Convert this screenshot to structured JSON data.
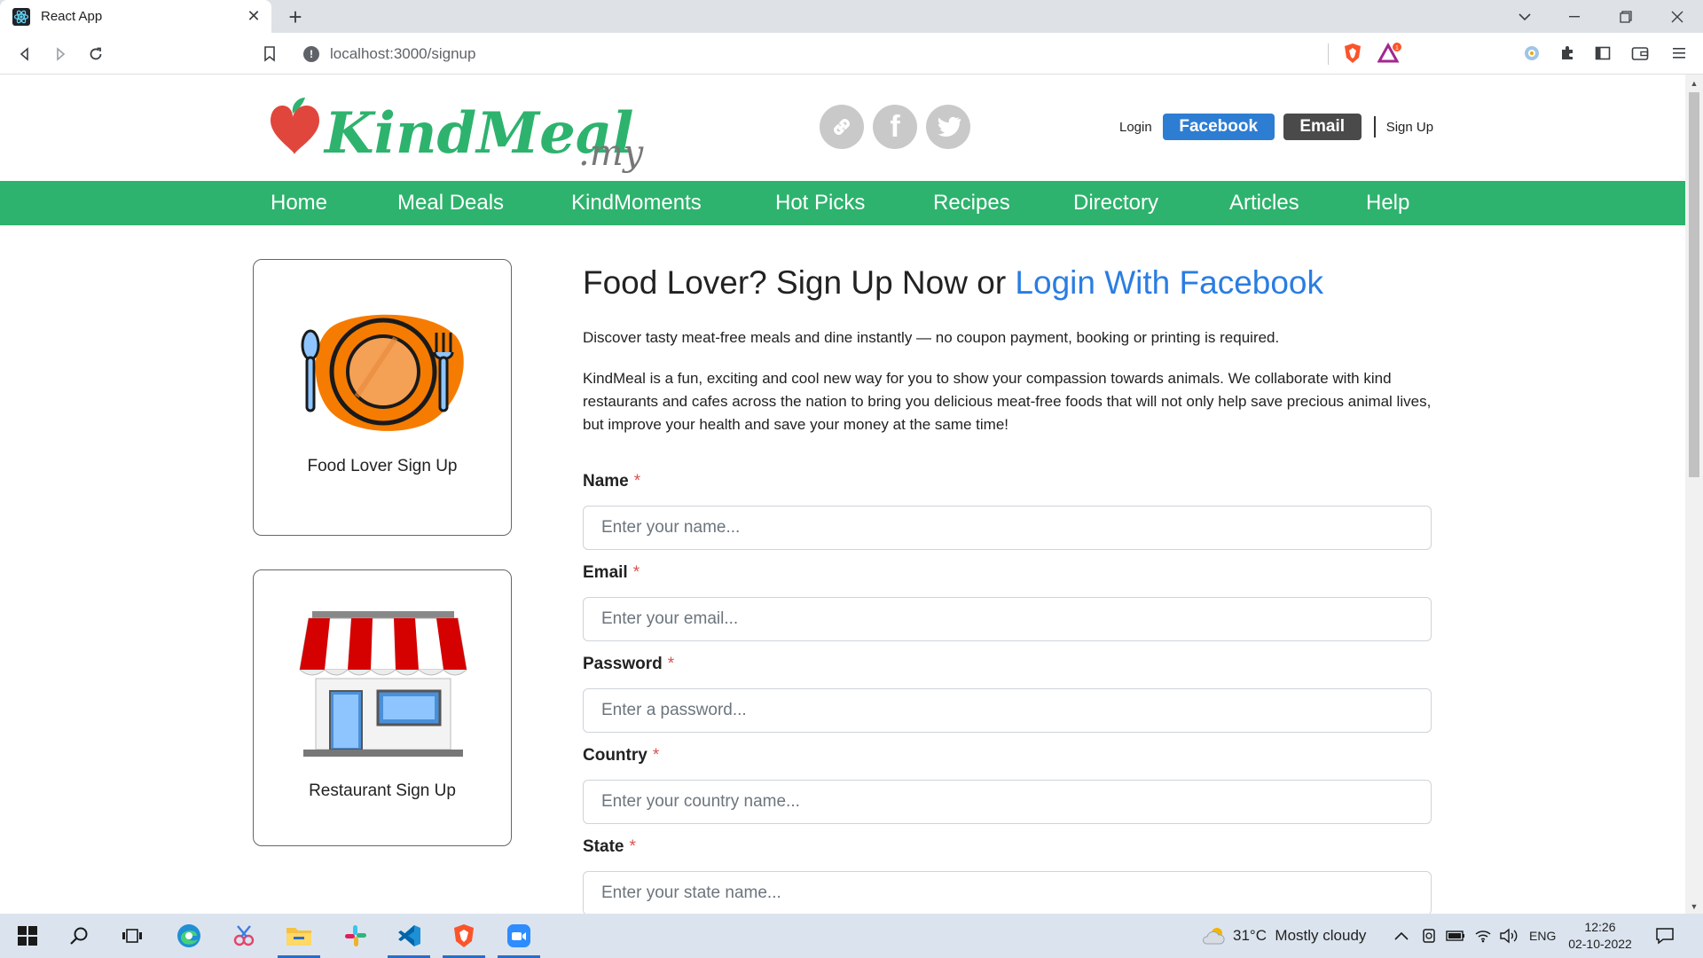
{
  "browser": {
    "tab_title": "React App",
    "url": "localhost:3000/signup",
    "badge_count": "1"
  },
  "header": {
    "logo_main": "KindMeal",
    "logo_suffix": ".my",
    "login_label": "Login",
    "facebook_button": "Facebook",
    "email_button": "Email",
    "signup_label": "Sign Up"
  },
  "nav": {
    "items": [
      "Home",
      "Meal Deals",
      "KindMoments",
      "Hot Picks",
      "Recipes",
      "Directory",
      "Articles",
      "Help"
    ]
  },
  "sidebar": {
    "food_lover_card": "Food Lover Sign Up",
    "restaurant_card": "Restaurant Sign Up"
  },
  "main": {
    "headline_text": "Food Lover? Sign Up Now or ",
    "headline_link": "Login With Facebook",
    "intro": "Discover tasty meat-free meals and dine instantly — no coupon payment, booking or printing is required.",
    "description": "KindMeal is a fun, exciting and cool new way for you to show your compassion towards animals. We collaborate with kind restaurants and cafes across the nation to bring you delicious meat-free foods that will not only help save precious animal lives, but improve your health and save your money at the same time!"
  },
  "form": {
    "required_mark": "*",
    "fields": [
      {
        "label": "Name",
        "placeholder": "Enter your name..."
      },
      {
        "label": "Email",
        "placeholder": "Enter your email..."
      },
      {
        "label": "Password",
        "placeholder": "Enter a password..."
      },
      {
        "label": "Country",
        "placeholder": "Enter your country name..."
      },
      {
        "label": "State",
        "placeholder": "Enter your state name..."
      }
    ]
  },
  "taskbar": {
    "weather": "31°C  Mostly cloudy",
    "language": "ENG",
    "time": "12:26",
    "date": "02-10-2022"
  },
  "colors": {
    "nav_green": "#2db36d",
    "facebook_blue": "#2d7dd2",
    "link_blue": "#2a7de1",
    "required_red": "#d9534f"
  }
}
